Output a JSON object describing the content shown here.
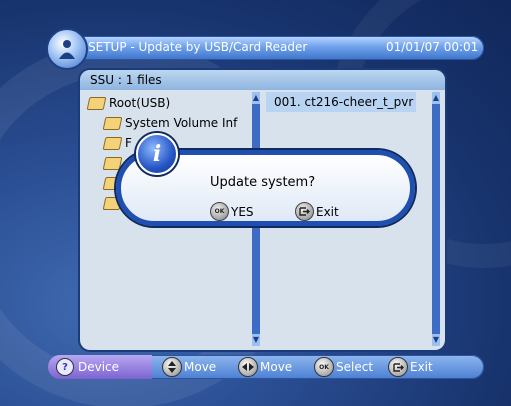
{
  "header": {
    "title": "SETUP - Update by USB/Card Reader",
    "datetime": "01/01/07 00:01"
  },
  "panel": {
    "ssu_label": "SSU :   1 files"
  },
  "left_list": {
    "root": "Root(USB)",
    "items": [
      "System Volume Inf",
      "F",
      "",
      "",
      ""
    ]
  },
  "right_list": {
    "items": [
      "001.  ct216-cheer_t_pvr"
    ]
  },
  "dialog": {
    "message": "Update system?",
    "yes_label": "YES",
    "exit_label": "Exit",
    "ok_key": "OK"
  },
  "footer": {
    "device": "Device",
    "move_updown": "Move",
    "move_leftright": "Move",
    "select": "Select",
    "exit": "Exit",
    "ok_key": "OK"
  }
}
